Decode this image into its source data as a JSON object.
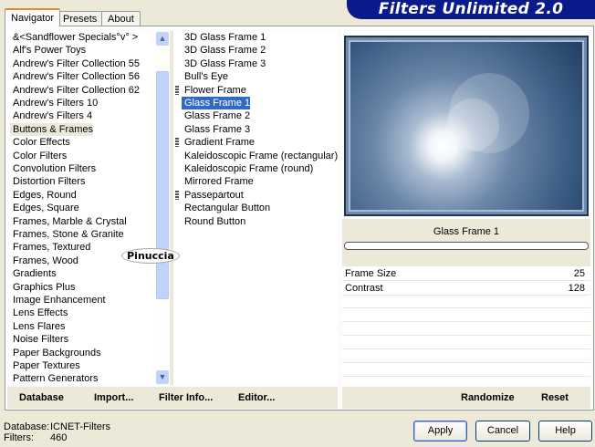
{
  "app": {
    "title": "Filters Unlimited 2.0"
  },
  "tabs": [
    {
      "label": "Navigator",
      "active": true
    },
    {
      "label": "Presets"
    },
    {
      "label": "About"
    }
  ],
  "categories": [
    "&<Sandflower Specials°v° >",
    "Alf's Power Toys",
    "Andrew's Filter Collection 55",
    "Andrew's Filter Collection 56",
    "Andrew's Filter Collection 62",
    "Andrew's Filters 10",
    "Andrew's Filters 4",
    "Buttons & Frames",
    "Color Effects",
    "Color Filters",
    "Convolution Filters",
    "Distortion Filters",
    "Edges, Round",
    "Edges, Square",
    "Frames, Marble & Crystal",
    "Frames, Stone & Granite",
    "Frames, Textured",
    "Frames, Wood",
    "Gradients",
    "Graphics Plus",
    "Image Enhancement",
    "Lens Effects",
    "Lens Flares",
    "Noise Filters",
    "Paper Backgrounds",
    "Paper Textures",
    "Pattern Generators"
  ],
  "selected_category": "Buttons & Frames",
  "filters": [
    {
      "label": "3D Glass Frame 1"
    },
    {
      "label": "3D Glass Frame 2"
    },
    {
      "label": "3D Glass Frame 3"
    },
    {
      "label": "Bull's Eye"
    },
    {
      "label": "Flower Frame",
      "grip": true
    },
    {
      "label": "Glass Frame 1",
      "selected": true
    },
    {
      "label": "Glass Frame 2"
    },
    {
      "label": "Glass Frame 3"
    },
    {
      "label": "Gradient Frame",
      "grip": true
    },
    {
      "label": "Kaleidoscopic Frame (rectangular)"
    },
    {
      "label": "Kaleidoscopic Frame (round)"
    },
    {
      "label": "Mirrored Frame"
    },
    {
      "label": "Passepartout",
      "grip": true
    },
    {
      "label": "Rectangular Button"
    },
    {
      "label": "Round Button"
    }
  ],
  "preview": {
    "filter_name": "Glass Frame 1"
  },
  "params": [
    {
      "label": "Frame Size",
      "value": "25"
    },
    {
      "label": "Contrast",
      "value": "128"
    }
  ],
  "watermark": "Pinuccia",
  "bottom_left": {
    "database": "Database",
    "import": "Import...",
    "filter_info": "Filter Info...",
    "editor": "Editor..."
  },
  "bottom_right": {
    "randomize": "Randomize",
    "reset": "Reset"
  },
  "status": {
    "database_label": "Database:",
    "database_value": "ICNET-Filters",
    "filters_label": "Filters:",
    "filters_value": "460"
  },
  "buttons": {
    "apply": "Apply",
    "cancel": "Cancel",
    "help": "Help"
  }
}
